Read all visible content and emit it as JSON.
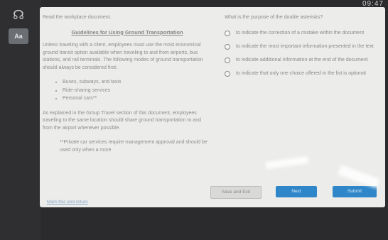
{
  "clock": "09:47",
  "rail": {
    "headphones_icon": "headphones-icon",
    "tts_icon": "text-to-speech-icon"
  },
  "left": {
    "instructions": "Read the workplace document.",
    "doc_title": "Guidelines for Using Ground Transportation",
    "para1": "Unless traveling with a client, employees must use the most economical ground transit option available when traveling to and from airports, bus stations, and rail terminals. The following modes of ground transportation should always be considered first:",
    "bullets": [
      "Buses, subways, and taxis",
      "Ride-sharing services",
      "Personal cars**"
    ],
    "para2": "As explained in the Group Travel section of this document, employees traveling to the same location should share ground transportation to and from the airport whenever possible.",
    "footnote": "**Private car services require management approval and should be used only when a more",
    "mark_link": "Mark this and return"
  },
  "right": {
    "question": "What is the purpose of the double asterisks?",
    "options": [
      "to indicate the correction of a mistake within the document",
      "to indicate the most important information presented in the text",
      "to indicate additional information at the end of the document",
      "to indicate that only one choice offered in the list is optional"
    ]
  },
  "buttons": {
    "save": "Save and Exit",
    "next": "Next",
    "submit": "Submit"
  },
  "colors": {
    "accent": "#2f86c8",
    "panel": "#ececea"
  }
}
